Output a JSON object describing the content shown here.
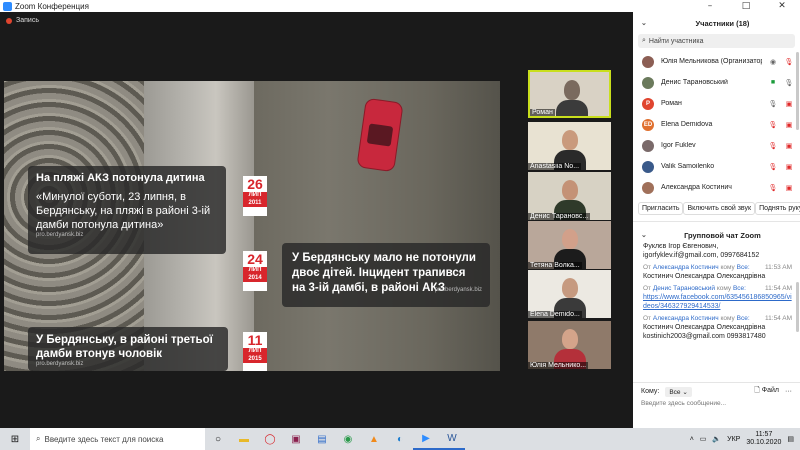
{
  "window": {
    "title": "Zoom Конференция",
    "controls": [
      "–",
      "□",
      "✕"
    ]
  },
  "recording": {
    "label": "Запись"
  },
  "shared_screen": {
    "watermark": "pro.berdyansk.biz",
    "stories": [
      {
        "headline": "На пляжі АКЗ потонула дитина",
        "body": "«Минулої суботи, 23 липня, в Бердянську, на пляжі в районі 3-ій дамби потонула дитина»",
        "source": "pro.berdyansk.biz"
      },
      {
        "headline": "",
        "body": "У Бердянську мало не потонули двоє дітей. Інцидент трапився на 3-ій дамбі, в районі АКЗ",
        "source": "pro.berdyansk.biz"
      },
      {
        "headline": "",
        "body": "У Бердянську, в районі третьої дамби втонув чоловік",
        "source": "pro.berdyansk.biz"
      }
    ],
    "dates": [
      {
        "day": "26",
        "month": "ЛИП",
        "year": "2011"
      },
      {
        "day": "24",
        "month": "ЛИП",
        "year": "2014"
      },
      {
        "day": "11",
        "month": "ЛИП",
        "year": "2015"
      }
    ]
  },
  "video_thumbnails": [
    {
      "name": "Роман",
      "active": true,
      "skin": "#7a6a5e",
      "shirt": "#3b3b3b",
      "bg": "#d9d2c5"
    },
    {
      "name": "Anastasiia No...",
      "active": false,
      "skin": "#c99a7c",
      "shirt": "#2a2a2a",
      "bg": "#e8e2d2"
    },
    {
      "name": "Денис Тарановс...",
      "active": false,
      "skin": "#c49276",
      "shirt": "#2f3a2a",
      "bg": "#d7d2c4"
    },
    {
      "name": "Тетяна Волка...",
      "active": false,
      "skin": "#d2a08a",
      "shirt": "#1c1c1c",
      "bg": "#b9a79a"
    },
    {
      "name": "Elena Demido...",
      "active": false,
      "skin": "#c69a80",
      "shirt": "#3a3a3a",
      "bg": "#ece9e2"
    },
    {
      "name": "Юлія Мельнико...",
      "active": false,
      "skin": "#d4a48a",
      "shirt": "#b4303a",
      "bg": "#8f7a6a"
    }
  ],
  "participants_panel": {
    "title": "Участники (18)",
    "search_placeholder": "Найти участника",
    "participants": [
      {
        "name": "Юлія Мельникова (Организатор)",
        "avatar": "",
        "avatar_color": "#8c5e54",
        "icons": [
          "record-icon",
          "mic-muted-icon"
        ]
      },
      {
        "name": "Денис Тарановський",
        "avatar": "",
        "avatar_color": "#6b7a5c",
        "icons": [
          "video-on-icon",
          "mic-icon"
        ]
      },
      {
        "name": "Роман",
        "avatar": "Р",
        "avatar_color": "#e0452f",
        "icons": [
          "mic-icon",
          "video-off-icon"
        ]
      },
      {
        "name": "Elena Demidova",
        "avatar": "ED",
        "avatar_color": "#e0702f",
        "icons": [
          "mic-muted-icon",
          "video-off-icon"
        ]
      },
      {
        "name": "Igor Fuklev",
        "avatar": "",
        "avatar_color": "#7a6a6a",
        "icons": [
          "mic-muted-icon",
          "video-off-icon"
        ]
      },
      {
        "name": "Valik Samoilenko",
        "avatar": "",
        "avatar_color": "#3a5a8a",
        "icons": [
          "mic-muted-icon",
          "video-off-icon"
        ]
      },
      {
        "name": "Александра Костинич",
        "avatar": "",
        "avatar_color": "#a0705a",
        "icons": [
          "mic-muted-icon",
          "video-off-icon"
        ]
      }
    ],
    "buttons": {
      "invite": "Пригласить",
      "unmute": "Включить свой звук",
      "raise_hand": "Поднять руку"
    }
  },
  "chat_panel": {
    "title": "Групповой чат Zoom",
    "messages": [
      {
        "from": "",
        "to": "",
        "time": "",
        "text": "Фуклєв Ігор Євгенович, igorfyklev.if@gmail.com, 0997684152",
        "link": ""
      },
      {
        "from": "Александра Костинич",
        "to": "Все:",
        "time": "11:53 AM",
        "text": "Костинич Олександра Олександрівна",
        "link": ""
      },
      {
        "from": "Денис Тарановський",
        "to": "Все:",
        "time": "11:54 AM",
        "text": "",
        "link": "https://www.facebook.com/635456186850965/videos/346327929414533/"
      },
      {
        "from": "Александра Костинич",
        "to": "Все:",
        "time": "11:54 AM",
        "text": "Костинич Олександра Олександрівна kostinich2003@gmail.com 0993817480",
        "link": ""
      }
    ],
    "from_prefix": "От",
    "to_prefix": "кому",
    "composer": {
      "to_label": "Кому:",
      "to_value": "Все",
      "file_label": "Файл",
      "more_label": "···",
      "placeholder": "Введите здесь сообщение..."
    }
  },
  "taskbar": {
    "search_placeholder": "Введите здесь текст для поиска",
    "apps": [
      "task-view-icon",
      "file-explorer-icon",
      "opera-icon",
      "adobe-icon",
      "save-icon",
      "chrome-icon",
      "vlc-icon",
      "edge-icon",
      "zoom-icon",
      "word-icon"
    ],
    "language": "УКР",
    "time": "11:57",
    "date": "30.10.2020"
  }
}
